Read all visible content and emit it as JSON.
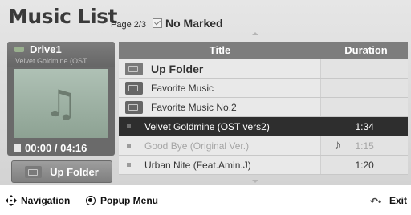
{
  "header": {
    "title": "Music List",
    "page_info": "Page 2/3",
    "marked_status": "No Marked"
  },
  "now_playing": {
    "drive_name": "Drive1",
    "song_title": "Velvet Goldmine (OST...",
    "time": "00:00 / 04:16"
  },
  "up_folder_button": "Up Folder",
  "list": {
    "columns": {
      "title": "Title",
      "duration": "Duration"
    },
    "rows": [
      {
        "title": "Up Folder",
        "duration": "",
        "type": "up-folder"
      },
      {
        "title": "Favorite Music",
        "duration": "",
        "type": "folder"
      },
      {
        "title": "Favorite Music No.2",
        "duration": "",
        "type": "folder"
      },
      {
        "title": "Velvet Goldmine (OST vers2)",
        "duration": "1:34",
        "type": "file",
        "state": "selected"
      },
      {
        "title": "Good Bye (Original Ver.)",
        "duration": "1:15",
        "type": "file",
        "state": "playing"
      },
      {
        "title": "Urban Nite (Feat.Amin.J)",
        "duration": "1:20",
        "type": "file"
      }
    ]
  },
  "footer": {
    "navigation": "Navigation",
    "popup_menu": "Popup Menu",
    "exit": "Exit"
  },
  "colors": {
    "selected_row_bg": "#2e2e2e",
    "header_bg": "#7d7d7d",
    "panel_bg": "#dcdcdc"
  }
}
